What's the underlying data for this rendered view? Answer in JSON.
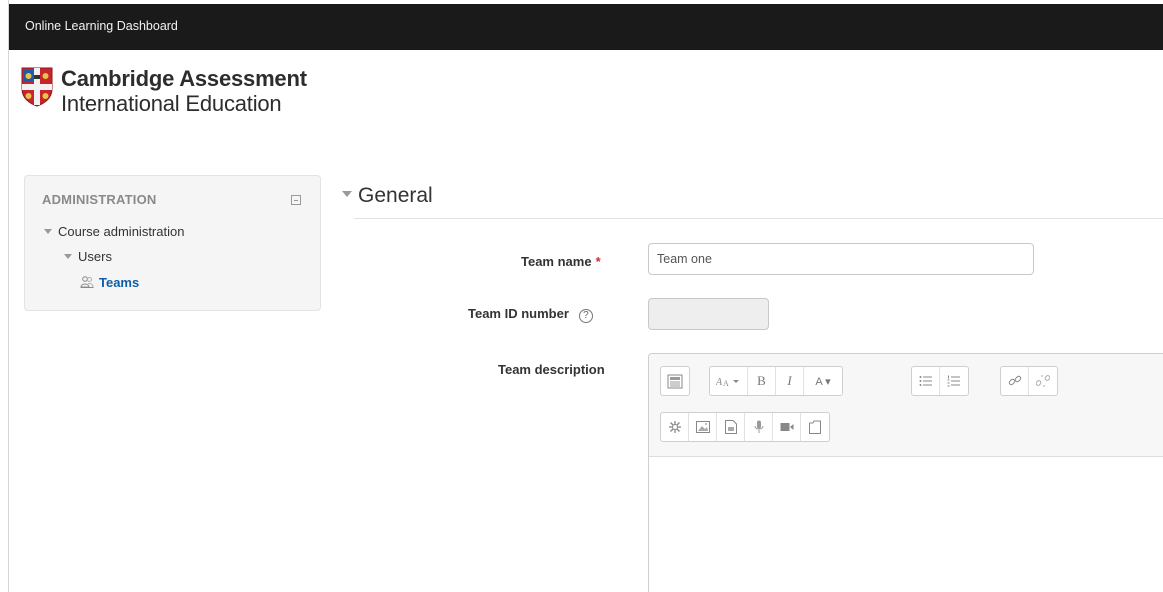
{
  "topbar": {
    "title": "Online Learning Dashboard"
  },
  "logo": {
    "line1": "Cambridge Assessment",
    "line2": "International Education"
  },
  "admin": {
    "title": "ADMINISTRATION",
    "tree": [
      {
        "label": "Course administration"
      },
      {
        "label": "Users"
      },
      {
        "label": "Teams"
      }
    ]
  },
  "form": {
    "section_title": "General",
    "team_name_label": "Team name",
    "required_marker": "*",
    "team_name_value": "Team one",
    "team_id_label": "Team ID number",
    "help_glyph": "?",
    "team_id_value": "",
    "team_description_label": "Team description"
  },
  "editor": {
    "toolbar_row1": [
      "toggle-toolbar-icon",
      "font-style-dropdown",
      "bold",
      "italic",
      "font-color-dropdown",
      "unordered-list-icon",
      "ordered-list-icon",
      "link-icon",
      "unlink-icon"
    ],
    "toolbar_row2": [
      "special-character-icon",
      "image-icon",
      "media-icon",
      "record-audio-icon",
      "record-video-icon",
      "manage-files-icon"
    ],
    "bold_glyph": "B",
    "italic_glyph": "I",
    "font_color_glyph": "A ▾"
  },
  "colors": {
    "topbar": "#1a1a1a",
    "link_blue": "#0f5da8",
    "required_red": "#c9302c"
  }
}
